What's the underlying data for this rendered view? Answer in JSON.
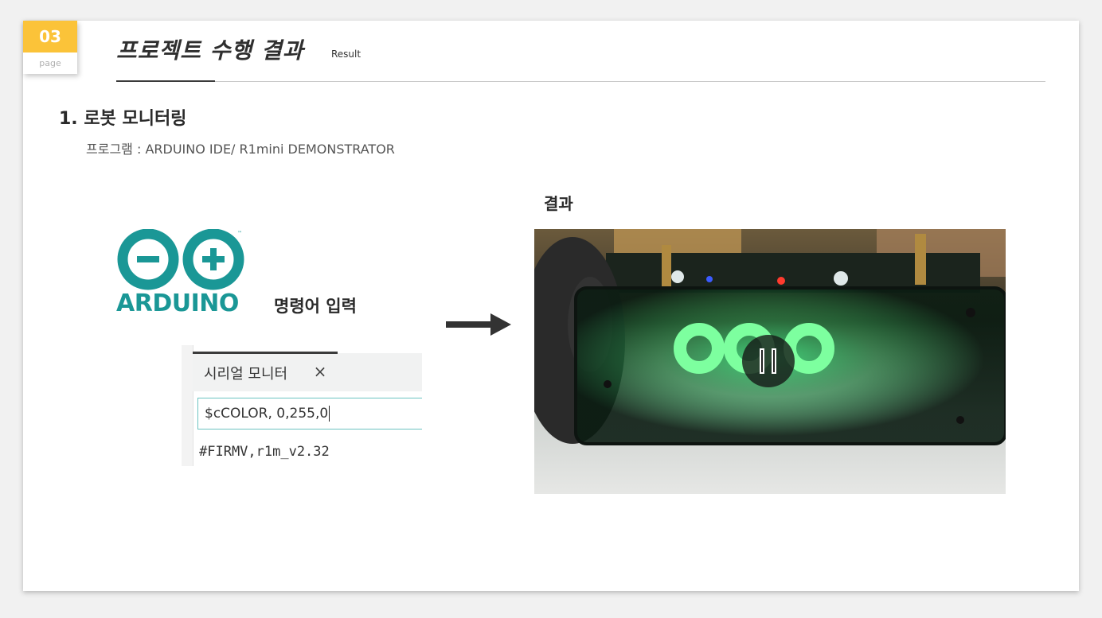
{
  "page_badge": {
    "number": "03",
    "label": "page"
  },
  "header": {
    "title": "프로젝트 수행 결과",
    "subtitle": "Result"
  },
  "section": {
    "heading": "1. 로봇 모니터링",
    "program_line": "프로그램 : ARDUINO IDE/ R1mini DEMONSTRATOR"
  },
  "arduino": {
    "logo_text": "ARDUINO",
    "trademark": "™",
    "command_label": "명령어 입력"
  },
  "serial_monitor": {
    "tab_label": "시리얼 모니터",
    "close_symbol": "×",
    "input_value": "$cCOLOR, 0,255,0",
    "output_line": "#FIRMV,r1m_v2.32"
  },
  "result": {
    "heading": "결과"
  },
  "colors": {
    "accent": "#fbc339",
    "arduino_teal": "#1a9796",
    "input_border": "#6cc3c1",
    "led_green": "#39e07a"
  },
  "icons": {
    "arrow": "right-arrow-icon",
    "close": "close-icon",
    "pause": "pause-icon"
  }
}
